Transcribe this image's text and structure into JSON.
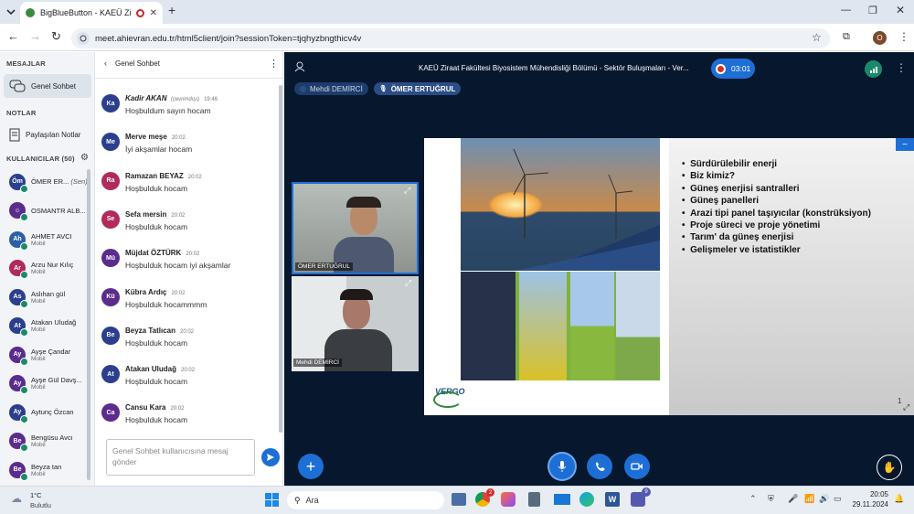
{
  "browser": {
    "tab_title": "BigBlueButton - KAEÜ Zira",
    "url": "meet.ahievran.edu.tr/html5client/join?sessionToken=tjqhyzbngthicv4v",
    "profile_initial": "O"
  },
  "nav": {
    "messages_header": "MESAJLAR",
    "public_chat": "Genel Sohbet",
    "notes_header": "NOTLAR",
    "shared_notes": "Paylaşılan Notlar",
    "users_header": "KULLANICILAR (50)"
  },
  "users": [
    {
      "initials": "Öm",
      "name": "ÖMER ER...",
      "suffix": "(Sen)",
      "sub": "",
      "color": "#2b3f8e"
    },
    {
      "initials": "☺",
      "name": "OSMANTR ALB...",
      "suffix": "",
      "sub": "",
      "color": "#5b2b8e"
    },
    {
      "initials": "Ah",
      "name": "AHMET AVCI",
      "suffix": "",
      "sub": "Mobil",
      "color": "#2b5fa6"
    },
    {
      "initials": "Ar",
      "name": "Arzu Nur Kılıç",
      "suffix": "",
      "sub": "Mobil",
      "color": "#b02a5c"
    },
    {
      "initials": "As",
      "name": "Aslıhan gül",
      "suffix": "",
      "sub": "Mobil",
      "color": "#2b3f8e"
    },
    {
      "initials": "At",
      "name": "Atakan Uludağ",
      "suffix": "",
      "sub": "Mobil",
      "color": "#2b3f8e"
    },
    {
      "initials": "Ay",
      "name": "Ayşe Çandar",
      "suffix": "",
      "sub": "Mobil",
      "color": "#5b2b8e"
    },
    {
      "initials": "Ay",
      "name": "Ayşe Gül Davş...",
      "suffix": "",
      "sub": "Mobil",
      "color": "#5b2b8e"
    },
    {
      "initials": "Ay",
      "name": "Aytunç Özcan",
      "suffix": "",
      "sub": "",
      "color": "#2b3f8e"
    },
    {
      "initials": "Be",
      "name": "Bengüsu Avcı",
      "suffix": "",
      "sub": "Mobil",
      "color": "#5b2b8e"
    },
    {
      "initials": "Be",
      "name": "Beyza tan",
      "suffix": "",
      "sub": "Mobil",
      "color": "#5b2b8e"
    }
  ],
  "chat": {
    "title": "Genel Sohbet",
    "input_placeholder": "Genel Sohbet kullanıcısına mesaj gönder",
    "messages": [
      {
        "initials": "Ka",
        "name": "Kadir AKAN",
        "status": "(çevrimdışı)",
        "time": "19:46",
        "text": "Hoşbuldum sayın hocam",
        "tone": "blue"
      },
      {
        "initials": "Me",
        "name": "Merve meşe",
        "status": "",
        "time": "20:02",
        "text": "İyi akşamlar hocam",
        "tone": "blue"
      },
      {
        "initials": "Ra",
        "name": "Ramazan BEYAZ",
        "status": "",
        "time": "20:02",
        "text": "Hoşbulduk hocam",
        "tone": "red"
      },
      {
        "initials": "Se",
        "name": "Sefa mersin",
        "status": "",
        "time": "20:02",
        "text": "Hoşbulduk hocam",
        "tone": "red"
      },
      {
        "initials": "Mü",
        "name": "Müjdat ÖZTÜRK",
        "status": "",
        "time": "20:02",
        "text": "Hoşbulduk hocam iyi akşamlar",
        "tone": "purple"
      },
      {
        "initials": "Kü",
        "name": "Kübra Ardıç",
        "status": "",
        "time": "20:02",
        "text": "Hoşbulduk hocammmm",
        "tone": "purple"
      },
      {
        "initials": "Be",
        "name": "Beyza Tatlıcan",
        "status": "",
        "time": "20:02",
        "text": "Hoşbulduk hocam",
        "tone": "blue"
      },
      {
        "initials": "At",
        "name": "Atakan Uludağ",
        "status": "",
        "time": "20:02",
        "text": "Hoşbulduk hocam",
        "tone": "blue"
      },
      {
        "initials": "Ca",
        "name": "Cansu Kara",
        "status": "",
        "time": "20:02",
        "text": "Hoşbulduk hocam",
        "tone": "purple"
      }
    ]
  },
  "meeting": {
    "title": "KAEÜ Ziraat Fakültesi Biyosistem Mühendisliği Bölümü - Sektör Buluşmaları - Ver...",
    "recording_time": "03:01",
    "presenters": [
      "Mehdi DEMİRCİ",
      "ÖMER ERTUĞRUL"
    ],
    "video_labels": [
      "ÖMER ERTUĞRUL",
      "Mehdi DEMİRCİ"
    ],
    "slide_number": "1",
    "slide_logo": "VERGO",
    "slide_bullets": [
      "Sürdürülebilir enerji",
      "Biz kimiz?",
      "Güneş enerjisi santralleri",
      "Güneş panelleri",
      "Arazi tipi panel taşıyıcılar (konstrüksiyon)",
      "Proje süreci ve proje yönetimi",
      "Tarım' da güneş enerjisi",
      "Gelişmeler ve istatistikler"
    ]
  },
  "taskbar": {
    "temperature": "1°C",
    "weather": "Bulutlu",
    "search_placeholder": "Ara",
    "time": "20:05",
    "date": "29.11.2024",
    "chrome_badge": "9",
    "teams_badge": "9",
    "notification_badge": "2"
  },
  "colors": {
    "accent": "#1d6fd6",
    "meeting_bg": "#06172e",
    "online": "#1b8a6b"
  }
}
